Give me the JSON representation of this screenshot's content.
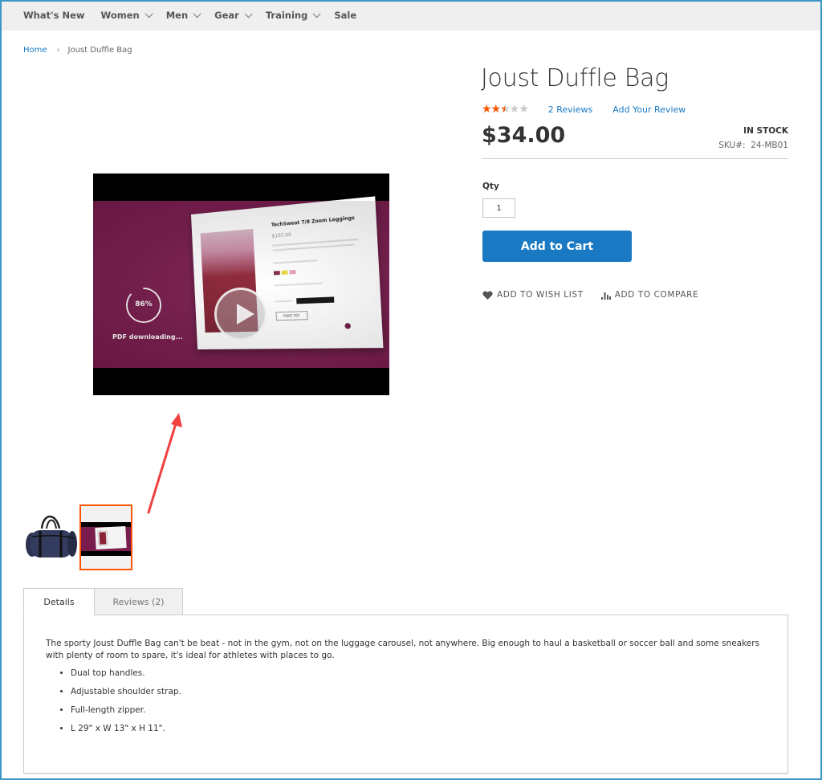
{
  "nav": {
    "items": [
      {
        "label": "What's New",
        "has_dropdown": false
      },
      {
        "label": "Women",
        "has_dropdown": true
      },
      {
        "label": "Men",
        "has_dropdown": true
      },
      {
        "label": "Gear",
        "has_dropdown": true
      },
      {
        "label": "Training",
        "has_dropdown": true
      },
      {
        "label": "Sale",
        "has_dropdown": false
      }
    ]
  },
  "breadcrumb": {
    "home": "Home",
    "separator": "›",
    "current": "Joust Duffle Bag"
  },
  "product": {
    "title": "Joust Duffle Bag",
    "rating": {
      "value": 2.5,
      "max": 5,
      "stars_glyph": "★★★★★"
    },
    "reviews_count_label": "2  Reviews",
    "add_review_label": "Add Your Review",
    "price": "$34.00",
    "stock": "IN STOCK",
    "sku_label": "SKU#:",
    "sku": "24-MB01",
    "qty_label": "Qty",
    "qty_value": "1",
    "add_to_cart_label": "Add to Cart",
    "wishlist_label": "ADD TO WISH LIST",
    "compare_label": "ADD TO COMPARE"
  },
  "media": {
    "video": {
      "overlay_progress_text": "86%",
      "overlay_progress_value": 0.86,
      "overlay_status": "PDF downloading...",
      "card_title": "TechSweat 7/8 Zoom Leggings",
      "card_price": "$107.00",
      "card_print_label": "PRINT PDF",
      "play_icon": "play-icon"
    },
    "thumbnails": [
      {
        "alt": "duffle-bag-image",
        "active": false
      },
      {
        "alt": "video-thumbnail",
        "active": true
      }
    ],
    "colors": {
      "accent": "#ff5501",
      "video_bg": "#7a1c4e",
      "annotation_arrow": "#f04040"
    }
  },
  "tabs": {
    "items": [
      {
        "label": "Details",
        "active": true
      },
      {
        "label": "Reviews (2)",
        "active": false
      }
    ]
  },
  "details": {
    "description": "The sporty Joust Duffle Bag can't be beat - not in the gym, not on the luggage carousel, not anywhere. Big enough to haul a basketball or soccer ball and some sneakers with plenty of room to spare, it's ideal for athletes with places to go.",
    "bullets": [
      "Dual top handles.",
      "Adjustable shoulder strap.",
      "Full-length zipper.",
      "L 29\" x W 13\" x H 11\"."
    ]
  },
  "theme": {
    "link_color": "#1979c3",
    "primary_button": "#1979c3",
    "star_color": "#ff5501",
    "frame_color": "#3d97c4"
  }
}
